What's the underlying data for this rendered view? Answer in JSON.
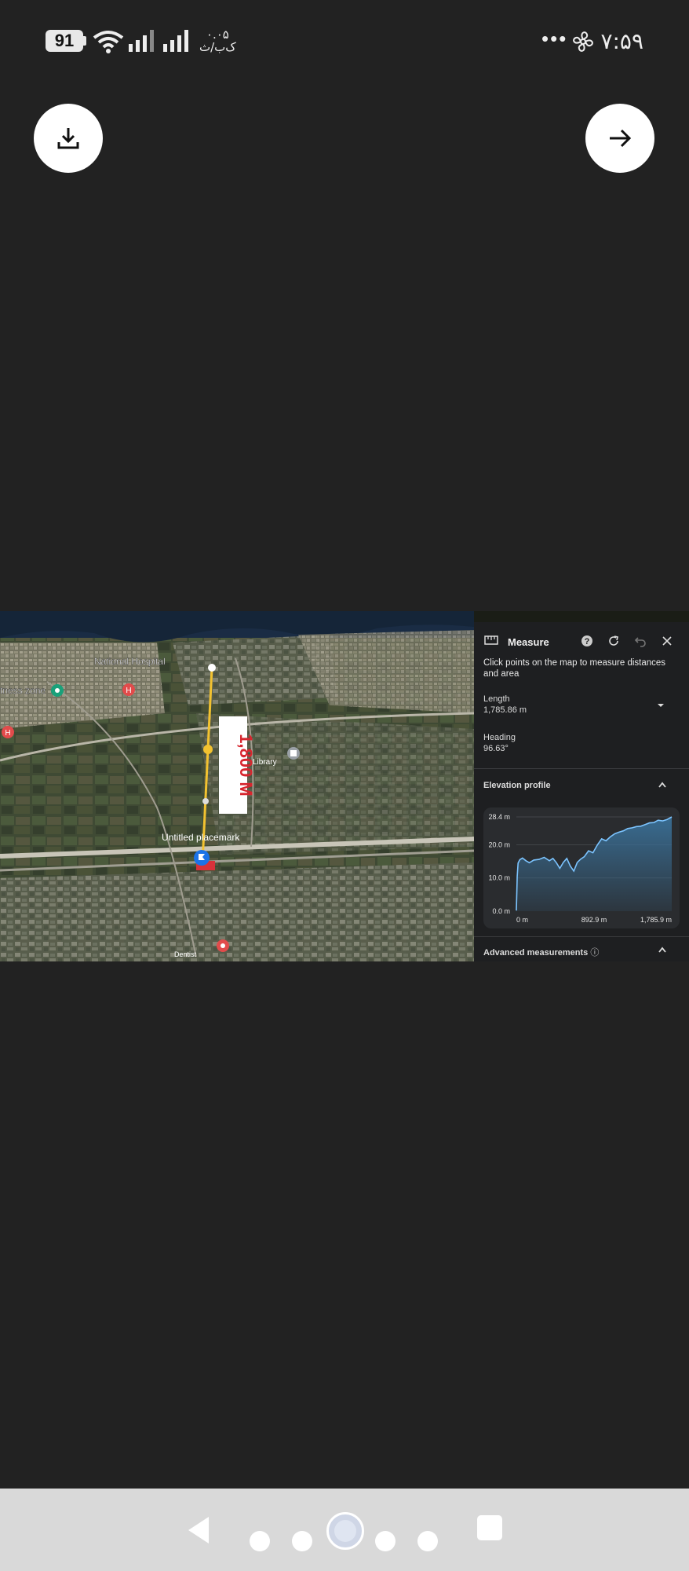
{
  "status_bar": {
    "battery": "91",
    "net_speed_value": "۰.۰۵",
    "net_speed_unit": "ک‌ب/ث",
    "time": "۷:۵۹",
    "more_dots": "•••"
  },
  "actions": {
    "download_icon": "download-icon",
    "next_icon": "arrow-right-icon"
  },
  "map": {
    "labels": {
      "national_hospital": "National Hospital",
      "fitness_zone": "tness zone",
      "library": "Library",
      "placemark": "Untitled placemark",
      "dentist": "Dentist"
    },
    "distance_label": "1,800 M"
  },
  "measure_panel": {
    "title": "Measure",
    "instruction": "Click points on the map to measure distances and area",
    "length_label": "Length",
    "length_value": "1,785.86 m",
    "heading_label": "Heading",
    "heading_value": "96.63°",
    "elevation_title": "Elevation profile",
    "advanced_title": "Advanced measurements",
    "info_icon": "ⓘ"
  },
  "chart_data": {
    "type": "area",
    "title": "Elevation profile",
    "x_tick_labels": [
      "0 m",
      "892.9 m",
      "1,785.9 m"
    ],
    "y_tick_labels": [
      "0.0 m",
      "10.0 m",
      "20.0 m",
      "28.4 m"
    ],
    "ylim": [
      0,
      28.4
    ],
    "xlim": [
      0,
      1785.9
    ],
    "grid": true,
    "series": [
      {
        "x": [
          0,
          10,
          20,
          40,
          70,
          110,
          150,
          200,
          260,
          320,
          380,
          420,
          460,
          500,
          540,
          580,
          620,
          660,
          700,
          740,
          780,
          830,
          880,
          930,
          980,
          1030,
          1080,
          1130,
          1180,
          1230,
          1280,
          1330,
          1380,
          1430,
          1480,
          1530,
          1580,
          1630,
          1680,
          1730,
          1785.9
        ],
        "values": [
          0.2,
          10.5,
          14.5,
          15.5,
          16,
          15.2,
          14.6,
          15.4,
          15.6,
          16.2,
          15.2,
          15.9,
          14.6,
          12.9,
          14.7,
          15.9,
          13.6,
          12.1,
          14.7,
          15.7,
          16.4,
          18.2,
          17.6,
          19.9,
          21.8,
          21.2,
          22.4,
          23.3,
          23.8,
          24.2,
          24.9,
          25.1,
          25.5,
          25.6,
          26.1,
          26.6,
          26.7,
          27.4,
          27.2,
          27.6,
          28.4
        ]
      }
    ],
    "colors": {
      "line": "#7cc4ff",
      "fill": "#3a6f96"
    }
  },
  "nav_bar": {
    "back": "back-icon",
    "home": "home-icon",
    "recents": "recents-icon"
  }
}
